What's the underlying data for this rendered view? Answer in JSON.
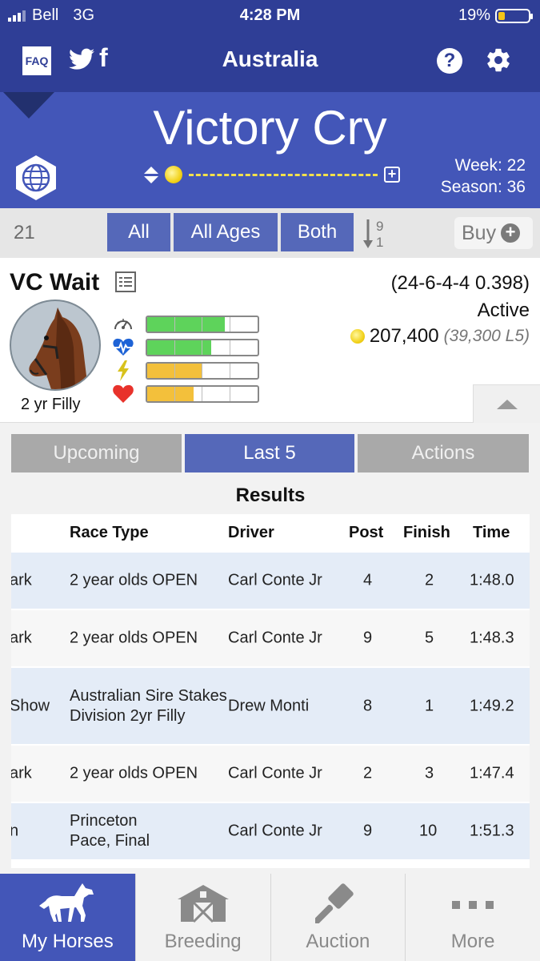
{
  "status_bar": {
    "carrier": "Bell",
    "network": "3G",
    "time": "4:28 PM",
    "battery": "19%"
  },
  "nav": {
    "faq_label": "FAQ",
    "region": "Australia"
  },
  "header": {
    "horse_title": "Victory Cry",
    "week": "Week: 22",
    "season": "Season: 36",
    "progress_fraction": 0.05
  },
  "filter": {
    "count": "21",
    "all": "All",
    "all_ages": "All Ages",
    "both": "Both",
    "sort_top": "9",
    "sort_bottom": "1",
    "buy": "Buy"
  },
  "horse": {
    "name": "VC Wait",
    "record": "(24-6-4-4 0.398)",
    "status": "Active",
    "earnings": "207,400",
    "last5": "(39,300 L5)",
    "age_sex": "2 yr Filly",
    "stats": [
      {
        "icon": "speedometer-icon",
        "level": 0.7,
        "color": "#5ed35b"
      },
      {
        "icon": "heartbeat-icon",
        "level": 0.58,
        "color": "#5ed35b"
      },
      {
        "icon": "lightning-icon",
        "level": 0.5,
        "color": "#f3c03b"
      },
      {
        "icon": "heart-icon",
        "level": 0.42,
        "color": "#f3c03b"
      }
    ]
  },
  "tabs": {
    "upcoming": "Upcoming",
    "last5": "Last 5",
    "actions": "Actions"
  },
  "results": {
    "title": "Results",
    "headers": {
      "race_type": "Race Type",
      "driver": "Driver",
      "post": "Post",
      "finish": "Finish",
      "time": "Time"
    },
    "rows": [
      {
        "track": "ark",
        "race_type": "2 year olds OPEN",
        "driver": "Carl Conte Jr",
        "post": "4",
        "finish": "2",
        "time": "1:48.0"
      },
      {
        "track": "ark",
        "race_type": "2 year olds OPEN",
        "driver": "Carl Conte Jr",
        "post": "9",
        "finish": "5",
        "time": "1:48.3"
      },
      {
        "track": "Show",
        "race_type": "Australian Sire Stakes Division 2yr Filly",
        "driver": "Drew Monti",
        "post": "8",
        "finish": "1",
        "time": "1:49.2"
      },
      {
        "track": "ark",
        "race_type": "2 year olds OPEN",
        "driver": "Carl Conte Jr",
        "post": "2",
        "finish": "3",
        "time": "1:47.4"
      },
      {
        "track": "n",
        "race_type": "Princeton Pace, Final",
        "driver": "Carl Conte Jr",
        "post": "9",
        "finish": "10",
        "time": "1:51.3"
      }
    ]
  },
  "bottom_nav": {
    "my_horses": "My Horses",
    "breeding": "Breeding",
    "auction": "Auction",
    "more": "More"
  },
  "colors": {
    "nav_blue": "#2f3e96",
    "header_blue": "#4356b8",
    "button_blue": "#5568b9",
    "tab_gray": "#a9a9a9"
  }
}
